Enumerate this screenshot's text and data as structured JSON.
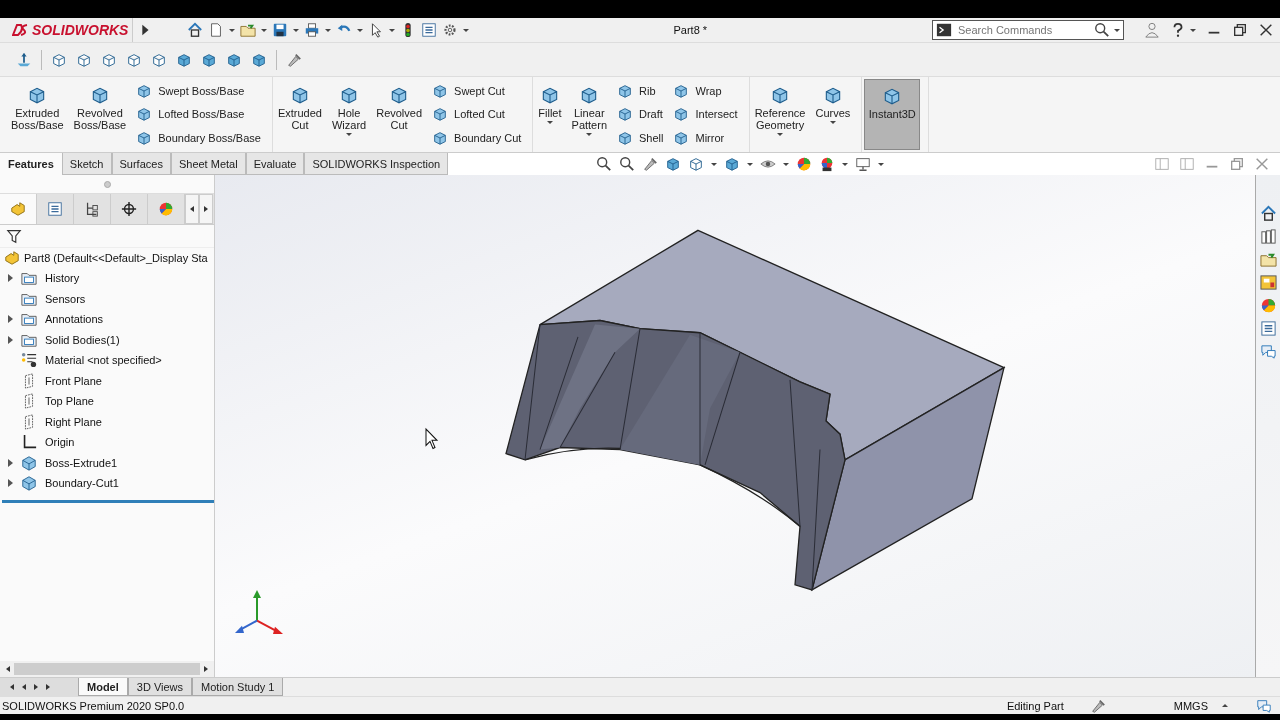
{
  "app": {
    "logo_text": "SOLIDWORKS",
    "title": "Part8 *"
  },
  "search": {
    "placeholder": "Search Commands"
  },
  "ribbon": [
    {
      "items": [
        {
          "kind": "large",
          "label": "Extruded\nBoss/Base",
          "dropdown": false,
          "on": false
        },
        {
          "kind": "large",
          "label": "Revolved\nBoss/Base",
          "dropdown": false,
          "on": false
        },
        {
          "kind": "stack",
          "labels": [
            "Swept Boss/Base",
            "Lofted Boss/Base",
            "Boundary Boss/Base"
          ]
        }
      ]
    },
    {
      "items": [
        {
          "kind": "large",
          "label": "Extruded\nCut",
          "dropdown": false,
          "on": false
        },
        {
          "kind": "large",
          "label": "Hole\nWizard",
          "dropdown": true,
          "on": false
        },
        {
          "kind": "large",
          "label": "Revolved\nCut",
          "dropdown": false,
          "on": false
        },
        {
          "kind": "stack",
          "labels": [
            "Swept Cut",
            "Lofted Cut",
            "Boundary Cut"
          ]
        }
      ]
    },
    {
      "items": [
        {
          "kind": "large",
          "label": "Fillet",
          "dropdown": true,
          "on": false
        },
        {
          "kind": "large",
          "label": "Linear\nPattern",
          "dropdown": true,
          "on": false
        },
        {
          "kind": "stack",
          "labels": [
            "Rib",
            "Draft",
            "Shell"
          ]
        },
        {
          "kind": "stack",
          "labels": [
            "Wrap",
            "Intersect",
            "Mirror"
          ]
        }
      ]
    },
    {
      "items": [
        {
          "kind": "large",
          "label": "Reference\nGeometry",
          "dropdown": true,
          "on": false
        },
        {
          "kind": "large",
          "label": "Curves",
          "dropdown": true,
          "on": false
        }
      ]
    },
    {
      "items": [
        {
          "kind": "large",
          "label": "Instant3D",
          "dropdown": false,
          "on": true
        }
      ]
    }
  ],
  "command_tabs": [
    {
      "label": "Features",
      "selected": true
    },
    {
      "label": "Sketch",
      "selected": false
    },
    {
      "label": "Surfaces",
      "selected": false
    },
    {
      "label": "Sheet Metal",
      "selected": false
    },
    {
      "label": "Evaluate",
      "selected": false
    },
    {
      "label": "SOLIDWORKS Inspection",
      "selected": false
    }
  ],
  "feature_tree": {
    "root": "Part8  (Default<<Default>_Display Sta",
    "items": [
      {
        "label": "History",
        "kind": "folder",
        "expandable": true
      },
      {
        "label": "Sensors",
        "kind": "folder",
        "expandable": false
      },
      {
        "label": "Annotations",
        "kind": "folder",
        "expandable": true
      },
      {
        "label": "Solid Bodies(1)",
        "kind": "folder",
        "expandable": true
      },
      {
        "label": "Material <not specified>",
        "kind": "material",
        "expandable": false
      },
      {
        "label": "Front Plane",
        "kind": "plane",
        "expandable": false
      },
      {
        "label": "Top Plane",
        "kind": "plane",
        "expandable": false
      },
      {
        "label": "Right Plane",
        "kind": "plane",
        "expandable": false
      },
      {
        "label": "Origin",
        "kind": "origin",
        "expandable": false
      },
      {
        "label": "Boss-Extrude1",
        "kind": "feature",
        "expandable": true
      },
      {
        "label": "Boundary-Cut1",
        "kind": "feature",
        "expandable": true
      }
    ]
  },
  "bottom_tabs": [
    {
      "label": "Model",
      "selected": true
    },
    {
      "label": "3D Views",
      "selected": false
    },
    {
      "label": "Motion Study 1",
      "selected": false
    }
  ],
  "status_bar": {
    "product": "SOLIDWORKS Premium 2020 SP0.0",
    "mode": "Editing Part",
    "units": "MMGS"
  }
}
